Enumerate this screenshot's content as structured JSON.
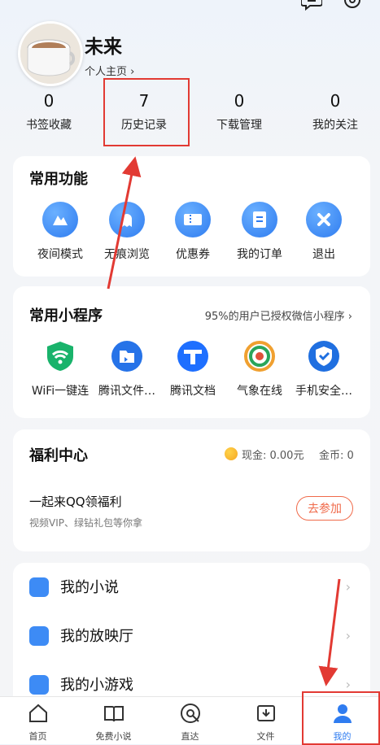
{
  "profile": {
    "name": "未来",
    "homepage_link": "个人主页 ›"
  },
  "stats": [
    {
      "value": "0",
      "label": "书签收藏"
    },
    {
      "value": "7",
      "label": "历史记录"
    },
    {
      "value": "0",
      "label": "下载管理"
    },
    {
      "value": "0",
      "label": "我的关注"
    }
  ],
  "common_functions": {
    "title": "常用功能",
    "items": [
      {
        "label": "夜间模式",
        "icon": "night-mode-icon"
      },
      {
        "label": "无痕浏览",
        "icon": "incognito-icon"
      },
      {
        "label": "优惠券",
        "icon": "coupon-icon"
      },
      {
        "label": "我的订单",
        "icon": "order-icon"
      },
      {
        "label": "退出",
        "icon": "exit-icon"
      }
    ]
  },
  "mini_programs": {
    "title": "常用小程序",
    "subtitle": "95%的用户已授权微信小程序 ›",
    "items": [
      {
        "label": "WiFi一键连",
        "icon": "wifi-icon"
      },
      {
        "label": "腾讯文件…",
        "icon": "tencent-file-icon"
      },
      {
        "label": "腾讯文档",
        "icon": "tencent-doc-icon"
      },
      {
        "label": "气象在线",
        "icon": "weather-icon"
      },
      {
        "label": "手机安全…",
        "icon": "phone-security-icon"
      }
    ]
  },
  "welfare": {
    "title": "福利中心",
    "cash": "现金: 0.00元",
    "coins": "金币: 0",
    "promo_title": "一起来QQ领福利",
    "promo_subtitle": "视频VIP、绿钻礼包等你拿",
    "join_button": "去参加"
  },
  "my_list": [
    {
      "label": "我的小说",
      "icon": "novel-icon"
    },
    {
      "label": "我的放映厅",
      "icon": "theater-icon"
    },
    {
      "label": "我的小游戏",
      "icon": "game-icon"
    }
  ],
  "tabbar": [
    {
      "label": "首页",
      "icon": "home-icon"
    },
    {
      "label": "免费小说",
      "icon": "book-icon"
    },
    {
      "label": "直达",
      "icon": "direct-icon"
    },
    {
      "label": "文件",
      "icon": "file-icon"
    },
    {
      "label": "我的",
      "icon": "profile-icon"
    }
  ],
  "colors": {
    "accent": "#2f7cf0",
    "annotation": "#e23a33",
    "join_button": "#f06a4a"
  }
}
